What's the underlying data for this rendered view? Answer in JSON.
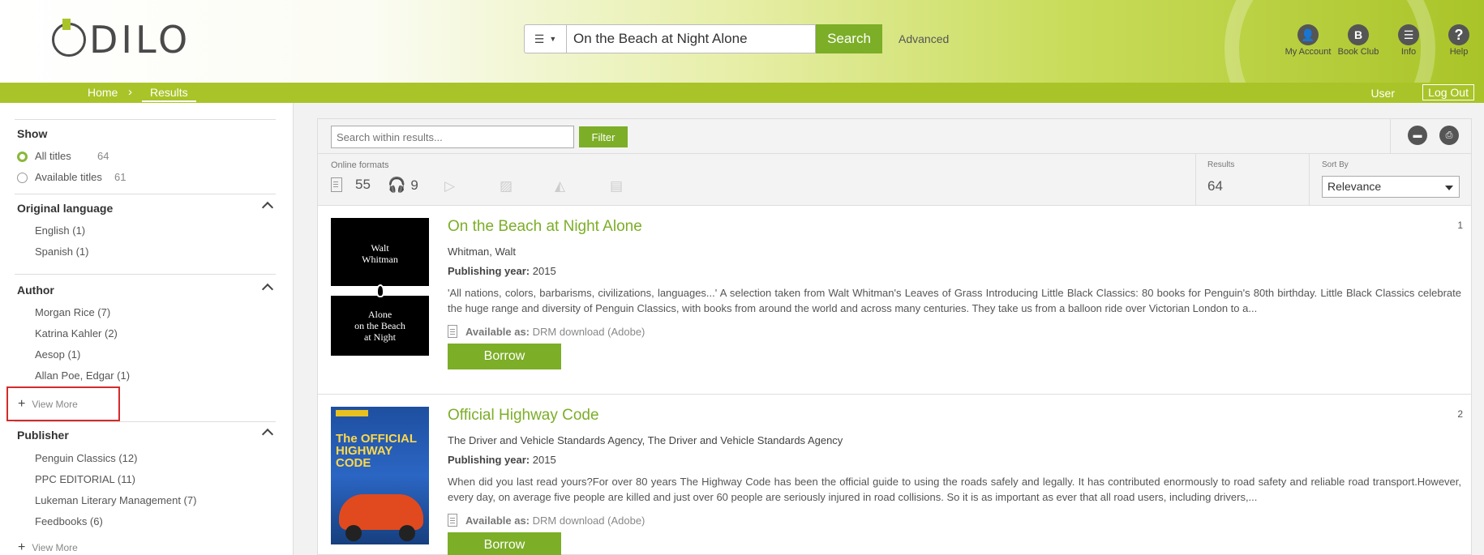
{
  "header": {
    "logo": "ODILO",
    "search": {
      "type_icon": "list-icon",
      "query": "On the Beach at Night Alone",
      "button": "Search",
      "advanced": "Advanced"
    },
    "icons": [
      {
        "label": "My Account",
        "glyph": "👤"
      },
      {
        "label": "Book Club",
        "glyph": "B"
      },
      {
        "label": "Info",
        "glyph": "☰"
      },
      {
        "label": "Help",
        "glyph": "?"
      }
    ]
  },
  "breadcrumb": {
    "home": "Home",
    "sep": "›",
    "current": "Results",
    "user": "User",
    "logout": "Log Out"
  },
  "sidebar": {
    "show": {
      "title": "Show",
      "options": [
        {
          "label": "All titles",
          "count": "64",
          "checked": true
        },
        {
          "label": "Available titles",
          "count": "61",
          "checked": false
        }
      ]
    },
    "language": {
      "title": "Original language",
      "items": [
        "English (1)",
        "Spanish (1)"
      ]
    },
    "author": {
      "title": "Author",
      "items": [
        "Morgan Rice (7)",
        "Katrina Kahler (2)",
        "Aesop (1)",
        "Allan Poe, Edgar (1)"
      ],
      "view_more": "View More"
    },
    "publisher": {
      "title": "Publisher",
      "items": [
        "Penguin Classics (12)",
        "PPC EDITORIAL (11)",
        "Lukeman Literary Management (7)",
        "Feedbooks (6)"
      ],
      "view_more": "View More"
    }
  },
  "toolbar": {
    "search_placeholder": "Search within results...",
    "filter": "Filter"
  },
  "formats": {
    "label": "Online formats",
    "ebooks": "55",
    "audio": "9",
    "results_label": "Results",
    "results_value": "64",
    "sort_label": "Sort By",
    "sort_value": "Relevance"
  },
  "results": [
    {
      "num": "1",
      "title": "On the Beach at Night Alone",
      "author": "Whitman, Walt",
      "year_label": "Publishing year:",
      "year": "2015",
      "description": "'All nations, colors, barbarisms, civilizations, languages...' A selection taken from Walt Whitman's Leaves of Grass Introducing Little Black Classics: 80 books for Penguin's 80th birthday. Little Black Classics celebrate the huge range and diversity of Penguin Classics, with books from around the world and across many centuries. They take us from a balloon ride over Victorian London to a...",
      "avail_label": "Available as:",
      "avail_value": "DRM download (Adobe)",
      "borrow": "Borrow",
      "cover_top": "Walt\nWhitman",
      "cover_bottom": "Alone\non the Beach\nat Night"
    },
    {
      "num": "2",
      "title": "Official Highway Code",
      "author": "The Driver and Vehicle Standards Agency, The Driver and Vehicle Standards Agency",
      "year_label": "Publishing year:",
      "year": "2015",
      "description": "When did you last read yours?For over 80 years The Highway Code has been the official guide to using the roads safely and legally. It has contributed enormously to road safety and reliable road transport.However, every day, on average five people are killed and just over 60 people are seriously injured in road collisions. So it is as important as ever that all road users, including drivers,...",
      "avail_label": "Available as:",
      "avail_value": "DRM download (Adobe)",
      "borrow": "Borrow",
      "cover_title": "The OFFICIAL HIGHWAY CODE"
    }
  ]
}
